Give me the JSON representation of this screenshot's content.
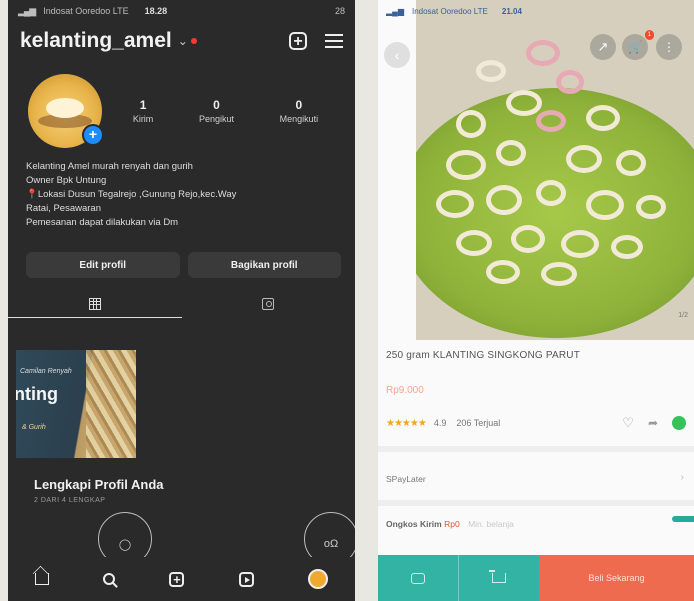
{
  "left": {
    "status": {
      "carrier": "Indosat Ooredoo LTE",
      "time": "18.28",
      "battery": "28"
    },
    "header": {
      "username": "kelanting_amel",
      "icons": [
        "plus-square-icon",
        "menu-icon"
      ]
    },
    "stats": [
      {
        "value": "1",
        "label": "Kirim"
      },
      {
        "value": "0",
        "label": "Pengikut"
      },
      {
        "value": "0",
        "label": "Mengikuti"
      }
    ],
    "bio": [
      "Kelanting Amel murah renyah dan gurih",
      "Owner Bpk Untung",
      "📍Lokasi Dusun Tegalrejo ,Gunung Rejo,kec.Way",
      "Ratai, Pesawaran",
      "Pemesanan dapat dilakukan via Dm"
    ],
    "buttons": {
      "edit": "Edit profil",
      "share": "Bagikan profil"
    },
    "post": {
      "sub": "Camilan Renyah",
      "big": "nting",
      "tag": "& Gurih"
    },
    "complete": {
      "title": "Lengkapi Profil Anda",
      "sub": "2 DARI 4 LENGKAP"
    },
    "cards": {
      "left_icon": "person-icon",
      "right_icon": "people-icon"
    },
    "nav": [
      "home-icon",
      "search-icon",
      "add-icon",
      "reels-icon",
      "profile-avatar"
    ]
  },
  "right": {
    "status": {
      "carrier": "Indosat Ooredoo LTE",
      "time": "21.04"
    },
    "image_counter": "1/2",
    "product": {
      "title": "250 gram KLANTING SINGKONG PARUT",
      "price": "Rp9.000",
      "rating": "4.9",
      "sold": "206 Terjual"
    },
    "spaylater": "SPayLater",
    "ongkos": {
      "label": "Ongkos Kirim",
      "value": "Rp0",
      "faint": "Min. belanja"
    },
    "cart_badge": "1",
    "bottom": {
      "buy": "Beli Sekarang"
    },
    "colors": {
      "shopee_orange": "#ee4d2d",
      "teal": "#33b3a4",
      "plate_green": "#8fb33a"
    }
  }
}
